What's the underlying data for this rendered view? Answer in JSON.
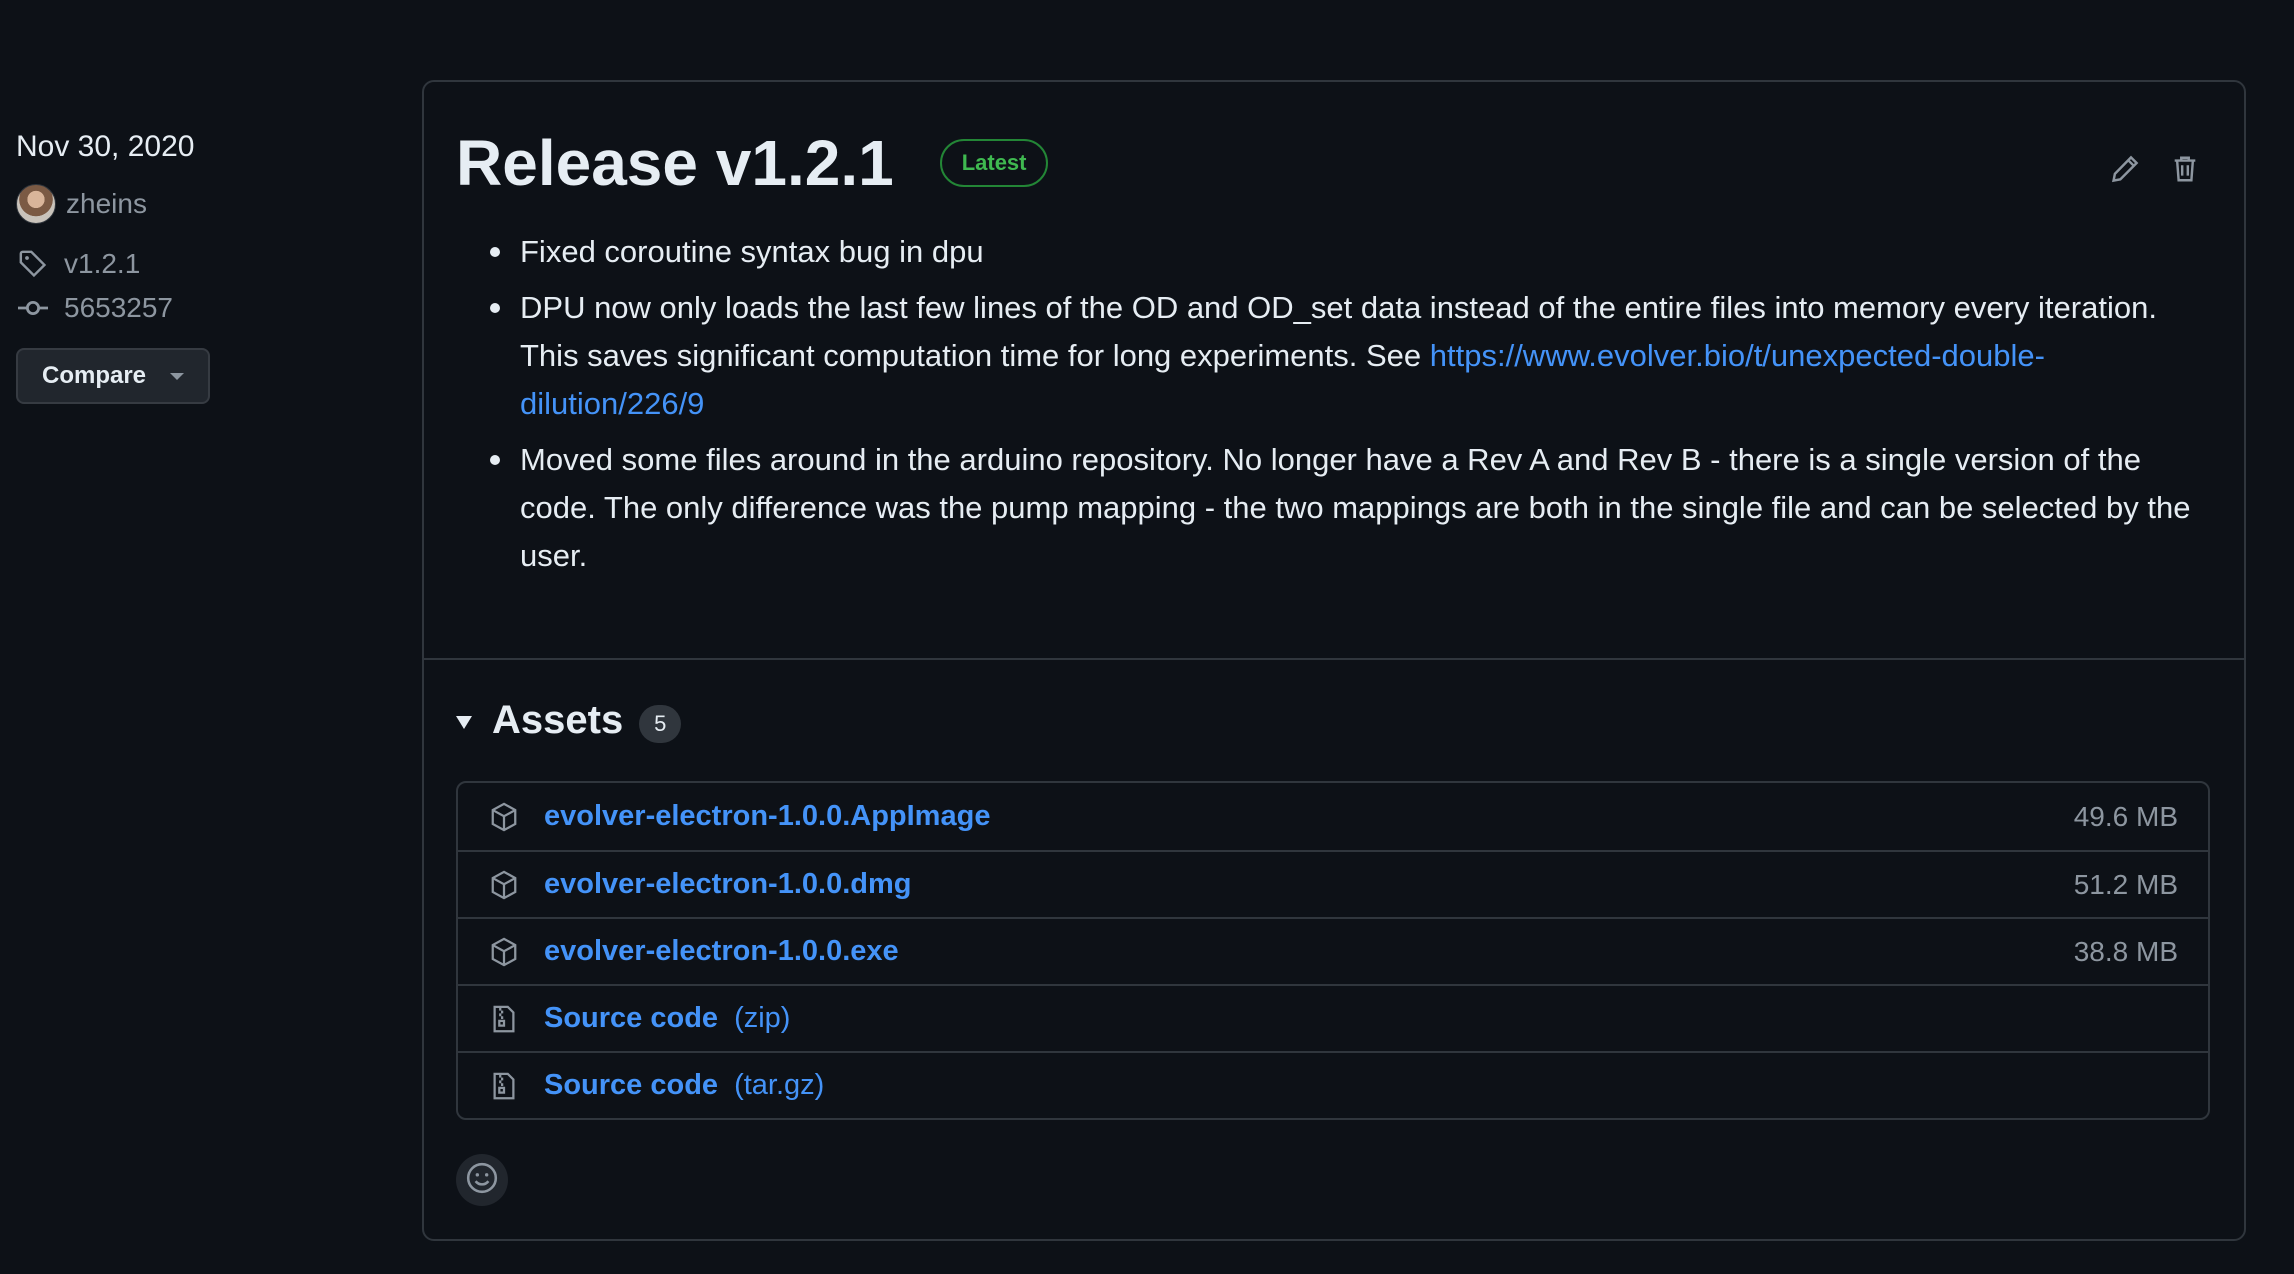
{
  "sidebar": {
    "date": "Nov 30, 2020",
    "author": "zheins",
    "tag": "v1.2.1",
    "commit": "5653257",
    "compare_label": "Compare"
  },
  "release": {
    "title": "Release v1.2.1",
    "badge": "Latest",
    "notes": [
      {
        "text": "Fixed coroutine syntax bug in dpu"
      },
      {
        "text": "DPU now only loads the last few lines of the OD and OD_set data instead of the entire files into memory every iteration. This saves significant computation time for long experiments. See ",
        "link": "https://www.evolver.bio/t/unexpected-double-dilution/226/9"
      },
      {
        "text": "Moved some files around in the arduino repository. No longer have a Rev A and Rev B - there is a single version of the code. The only difference was the pump mapping - the two mappings are both in the single file and can be selected by the user."
      }
    ]
  },
  "assets": {
    "title": "Assets",
    "count": "5",
    "items": [
      {
        "name": "evolver-electron-1.0.0.AppImage",
        "size": "49.6 MB",
        "icon": "package-icon"
      },
      {
        "name": "evolver-electron-1.0.0.dmg",
        "size": "51.2 MB",
        "icon": "package-icon"
      },
      {
        "name": "evolver-electron-1.0.0.exe",
        "size": "38.8 MB",
        "icon": "package-icon"
      },
      {
        "name": "Source code",
        "sub": "(zip)",
        "icon": "file-zip-icon"
      },
      {
        "name": "Source code",
        "sub": "(tar.gz)",
        "icon": "file-zip-icon"
      }
    ]
  },
  "colors": {
    "background": "#0d1117",
    "border": "#30363d",
    "link": "#4493f8",
    "latest_badge": "#3fb950",
    "muted_text": "#8d96a0"
  }
}
